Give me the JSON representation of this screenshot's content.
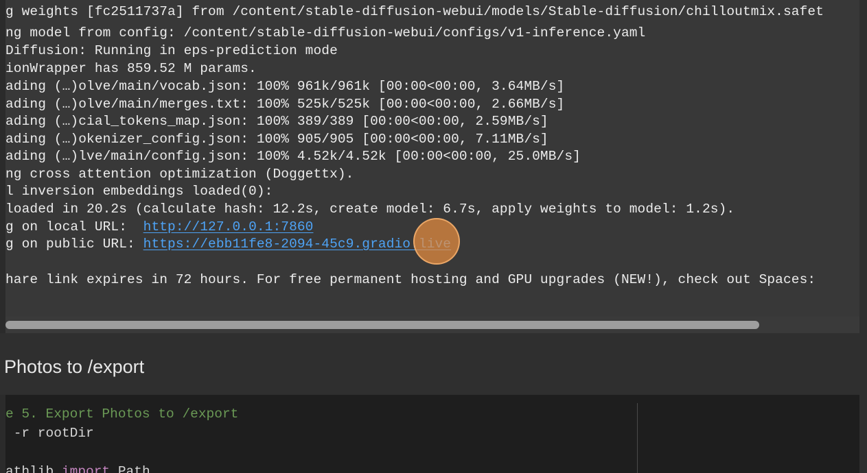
{
  "terminal": {
    "lines": [
      "g weights [fc2511737a] from /content/stable-diffusion-webui/models/Stable-diffusion/chilloutmix.safet",
      "ng model from config: /content/stable-diffusion-webui/configs/v1-inference.yaml",
      "Diffusion: Running in eps-prediction mode",
      "ionWrapper has 859.52 M params.",
      "ading (…)olve/main/vocab.json: 100% 961k/961k [00:00<00:00, 3.64MB/s]",
      "ading (…)olve/main/merges.txt: 100% 525k/525k [00:00<00:00, 2.66MB/s]",
      "ading (…)cial_tokens_map.json: 100% 389/389 [00:00<00:00, 2.59MB/s]",
      "ading (…)okenizer_config.json: 100% 905/905 [00:00<00:00, 7.11MB/s]",
      "ading (…)lve/main/config.json: 100% 4.52k/4.52k [00:00<00:00, 25.0MB/s]",
      "ng cross attention optimization (Doggettx).",
      "l inversion embeddings loaded(0):",
      "loaded in 20.2s (calculate hash: 12.2s, create model: 6.7s, apply weights to model: 1.2s)."
    ],
    "local_url_prefix": "g on local URL:  ",
    "local_url": "http://127.0.0.1:7860",
    "public_url_prefix": "g on public URL: ",
    "public_url": "https://ebb11fe8-2094-45c9.gradio.live",
    "share_notice": "hare link expires in 72 hours. For free permanent hosting and GPU upgrades (NEW!), check out Spaces:"
  },
  "section": {
    "title": "Photos to /export"
  },
  "code": {
    "comment": "e 5. Export Photos to /export",
    "line2": " -r rootDir",
    "line4_prefix": "athlib ",
    "line4_keyword": "import",
    "line4_suffix": " Path"
  },
  "colors": {
    "link": "#4ea3f5",
    "cursor_highlight": "#e88e40",
    "comment": "#6a9955",
    "keyword": "#c586c0"
  }
}
